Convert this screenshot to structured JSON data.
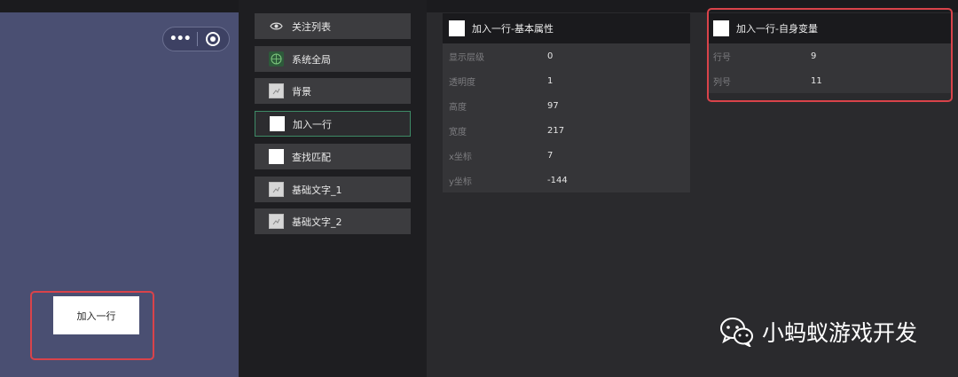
{
  "preview": {
    "capsule_menu": "•••",
    "button_label": "加入一行"
  },
  "component_list": {
    "items": [
      {
        "label": "关注列表",
        "icon": "eye-icon"
      },
      {
        "label": "系统全局",
        "icon": "globe-icon"
      },
      {
        "label": "背景",
        "icon": "image-icon"
      },
      {
        "label": "加入一行",
        "icon": "white-square-icon",
        "selected": true
      },
      {
        "label": "查找匹配",
        "icon": "white-square-icon"
      },
      {
        "label": "基础文字_1",
        "icon": "image-icon"
      },
      {
        "label": "基础文字_2",
        "icon": "image-icon"
      }
    ]
  },
  "basic_props": {
    "title": "加入一行-基本属性",
    "rows": [
      {
        "key": "显示层级",
        "value": "0"
      },
      {
        "key": "透明度",
        "value": "1"
      },
      {
        "key": "高度",
        "value": "97"
      },
      {
        "key": "宽度",
        "value": "217"
      },
      {
        "key": "x坐标",
        "value": "7"
      },
      {
        "key": "y坐标",
        "value": "-144"
      }
    ]
  },
  "self_vars": {
    "title": "加入一行-自身变量",
    "rows": [
      {
        "key": "行号",
        "value": "9"
      },
      {
        "key": "列号",
        "value": "11"
      }
    ]
  },
  "watermark": {
    "text": "小蚂蚁游戏开发"
  },
  "colors": {
    "highlight": "#d9434a",
    "preview_bg": "#4a4f72",
    "selected_border": "#3e8a66"
  }
}
